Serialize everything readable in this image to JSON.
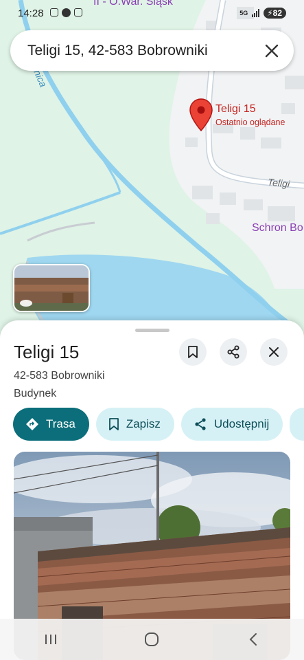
{
  "status_bar": {
    "time": "14:28",
    "network": "5G",
    "battery": "82"
  },
  "map": {
    "top_partial_label": "II - O.War. Śląsk",
    "river_label": "nica",
    "pin_title": "Teligi 15",
    "pin_subtitle": "Ostatnio oglądane",
    "road_label": "Teligi",
    "poi_label": "Schron Bo",
    "colors": {
      "land": "#dff3e6",
      "water": "#9fd7f0",
      "urban": "#f1f3f4",
      "pin": "#ea4335",
      "poi": "#8b3fb5"
    }
  },
  "search": {
    "query": "Teligi 15, 42-583 Bobrowniki",
    "clear_icon": "close-icon"
  },
  "place": {
    "title": "Teligi 15",
    "address": "42-583 Bobrowniki",
    "category": "Budynek",
    "actions": [
      {
        "label": "Trasa",
        "icon": "directions-icon"
      },
      {
        "label": "Zapisz",
        "icon": "bookmark-icon"
      },
      {
        "label": "Udostępnij",
        "icon": "share-icon"
      }
    ],
    "header_icons": [
      "bookmark-icon",
      "share-icon",
      "close-icon"
    ]
  }
}
